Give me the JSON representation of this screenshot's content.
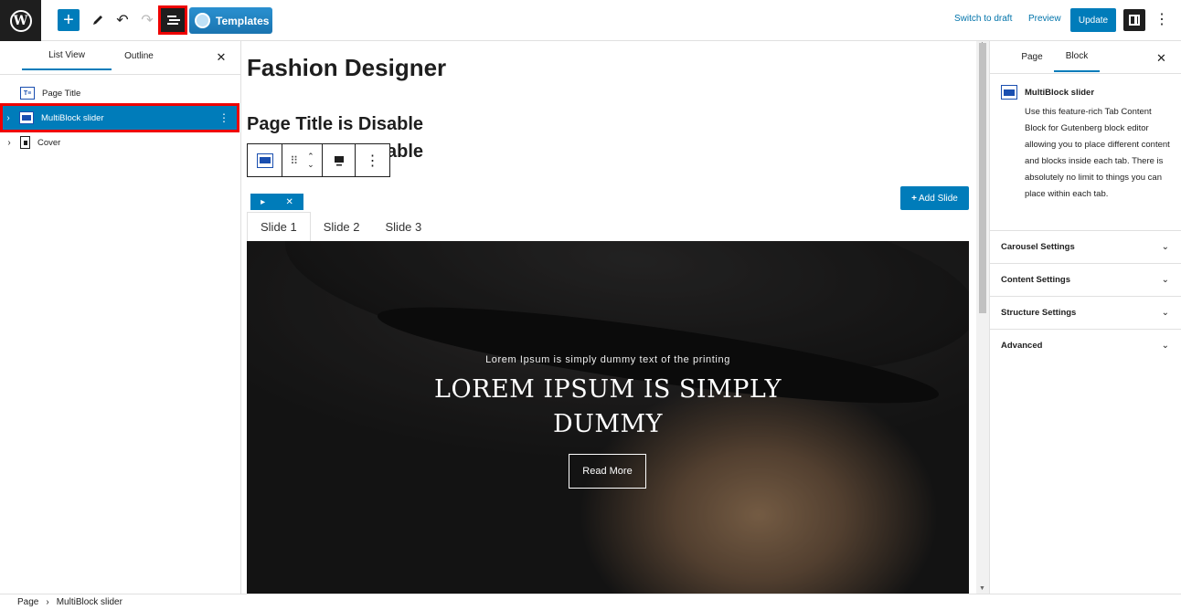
{
  "topbar": {
    "templates_label": "Templates",
    "switch_to_draft": "Switch to draft",
    "preview": "Preview",
    "update": "Update"
  },
  "left_panel": {
    "tabs": [
      "List View",
      "Outline"
    ],
    "items": [
      {
        "label": "Page Title",
        "icon": "page-title-icon"
      },
      {
        "label": "MultiBlock slider",
        "icon": "slider-icon"
      },
      {
        "label": "Cover",
        "icon": "cover-icon"
      }
    ]
  },
  "canvas": {
    "doc_title": "Fashion Designer",
    "heading1": "Page Title is Disable",
    "heading2": "Page Title is Disable",
    "add_slide": "Add Slide",
    "slide_tabs": [
      "Slide 1",
      "Slide 2",
      "Slide 3"
    ],
    "hero_sub": "Lorem Ipsum is simply dummy text of the printing",
    "hero_title": "LOREM IPSUM IS SIMPLY DUMMY",
    "hero_button": "Read More"
  },
  "right_panel": {
    "tabs": [
      "Page",
      "Block"
    ],
    "block_name": "MultiBlock slider",
    "block_desc": "Use this feature-rich Tab Content Block for Gutenberg block editor allowing you to place different content and blocks inside each tab. There is absolutely no limit to things you can place within each tab.",
    "sections": [
      "Carousel Settings",
      "Content Settings",
      "Structure Settings",
      "Advanced"
    ]
  },
  "breadcrumb": {
    "root": "Page",
    "sep": "›",
    "current": "MultiBlock slider"
  },
  "colors": {
    "accent": "#007cba",
    "highlight": "#e00000",
    "dark": "#1e1e1e"
  }
}
